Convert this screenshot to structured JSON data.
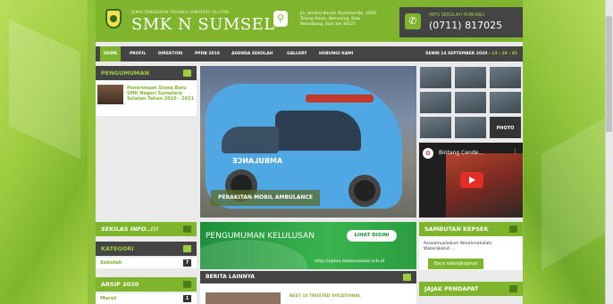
{
  "header": {
    "dinas": "DINAS PENDIDIKAN PROVINSI SUMATERA SELATAN",
    "school": "SMK N SUMSEL",
    "address": "Jln. Jendral Basuki Rachmad No. 2050, Talang Aman, Kemuning, Kota Palembang, Sum Sel 30127",
    "info_title": "INFO SEKOLAH HUBUNGI",
    "phone": "(0711) 817025"
  },
  "nav": {
    "items": [
      "HOME",
      "PROFIL",
      "DIREKTORI",
      "PPDB 2019",
      "AGENDA SEKOLAH",
      "GALLERY",
      "HUBUNGI KAMI"
    ],
    "date": "SENIN 14 SEPTEMBER 2020 - ",
    "time": "13 : 29 : 45"
  },
  "left": {
    "pengumuman_title": "PENGUMUMAN",
    "announcement": "Penerimaan Siswa Baru SMK Negeri Sumatera Selatan Tahun 2020 - 2021",
    "sekilas_title": "SEKILAS INFO..!!!",
    "kategori_title": "KATEGORI",
    "kategori_item": "Sekolah",
    "kategori_count": "7",
    "arsip_title": "ARSIP 2020",
    "arsip_item": "Maret",
    "arsip_count": "1"
  },
  "slider": {
    "caption": "PERAKITAN MOBIL AMBULANCE",
    "vehicle_text": "AMBULANCE"
  },
  "gallery": {
    "photo_label": "PHOTO"
  },
  "video": {
    "title": "Bintang Cende...",
    "menu": "⋮"
  },
  "announce": {
    "title": "PENGUMUMAN KELULUSAN",
    "button": "LIHAT DISINI",
    "url": "http://aplus.smknsumsel.sch.id"
  },
  "berita": {
    "title": "BERITA LAINNYA",
    "item": "BEST 10 TRUSTED VOCATIONAL"
  },
  "right": {
    "sambutan_title": "SAMBUTAN KEPSEK",
    "sambutan_text": "Assalamualaikum Warahmatullahi Wabarakatuh ...",
    "sambutan_button": "Baca selengkapnya",
    "jajak_title": "JAJAK PENDAPAT"
  },
  "icons": {
    "pin": "location-pin-icon",
    "phone": "phone-icon",
    "play": "play-icon"
  },
  "colors": {
    "accent": "#7fb52c",
    "dark": "#444444",
    "announce_green": "#1d8f3a"
  }
}
